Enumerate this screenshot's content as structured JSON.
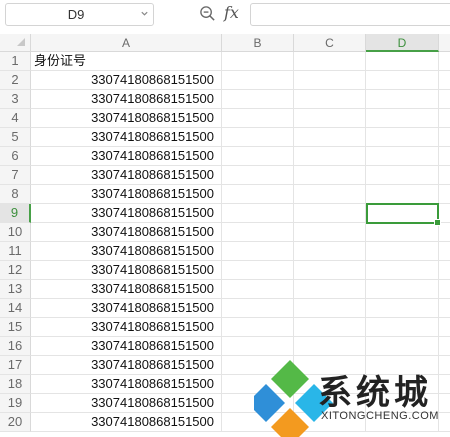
{
  "formula_bar": {
    "name_box": "D9",
    "fx_label": "fx",
    "formula_value": ""
  },
  "columns": [
    "A",
    "B",
    "C",
    "D"
  ],
  "active_column": "D",
  "active_row": "9",
  "rows": [
    {
      "num": "1",
      "a": "身份证号"
    },
    {
      "num": "2",
      "a": "33074180868151500"
    },
    {
      "num": "3",
      "a": "33074180868151500"
    },
    {
      "num": "4",
      "a": "33074180868151500"
    },
    {
      "num": "5",
      "a": "33074180868151500"
    },
    {
      "num": "6",
      "a": "33074180868151500"
    },
    {
      "num": "7",
      "a": "33074180868151500"
    },
    {
      "num": "8",
      "a": "33074180868151500"
    },
    {
      "num": "9",
      "a": "33074180868151500"
    },
    {
      "num": "10",
      "a": "33074180868151500"
    },
    {
      "num": "11",
      "a": "33074180868151500"
    },
    {
      "num": "12",
      "a": "33074180868151500"
    },
    {
      "num": "13",
      "a": "33074180868151500"
    },
    {
      "num": "14",
      "a": "33074180868151500"
    },
    {
      "num": "15",
      "a": "33074180868151500"
    },
    {
      "num": "16",
      "a": "33074180868151500"
    },
    {
      "num": "17",
      "a": "33074180868151500"
    },
    {
      "num": "18",
      "a": "33074180868151500"
    },
    {
      "num": "19",
      "a": "33074180868151500"
    },
    {
      "num": "20",
      "a": "33074180868151500"
    }
  ],
  "watermark": {
    "title": "系统城",
    "subtitle": "XITONGCHENG.COM",
    "colors": {
      "blue": "#2f8fd8",
      "green": "#54b947",
      "orange": "#f39a1f",
      "cyan": "#29b6e8"
    }
  },
  "colors": {
    "selection": "#3a9b3a",
    "header_bg": "#f5f5f5",
    "gridline": "#e4e4e4"
  }
}
